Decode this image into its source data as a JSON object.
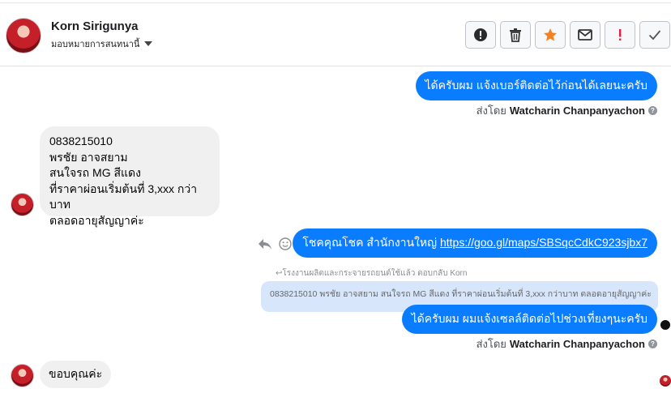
{
  "header": {
    "contact_name": "Korn Sirigunya",
    "assign_label": "มอบหมายการสนทนานี้"
  },
  "toolbar": {
    "buttons": [
      {
        "icon": "alert-icon"
      },
      {
        "icon": "trash-icon"
      },
      {
        "icon": "star-icon"
      },
      {
        "icon": "mail-icon"
      },
      {
        "icon": "exclamation-icon"
      },
      {
        "icon": "check-icon"
      }
    ]
  },
  "messages": {
    "m1": "ได้ครับผม แจ้งเบอร์ติดต่อไว้ก่อนได้เลยนะครับ",
    "m1_sentby_prefix": "ส่งโดย",
    "m1_sentby_name": "Watcharin Chanpanyachon",
    "m2_lines": [
      "0838215010",
      "พรชัย อาจสยาม",
      "สนใจรถ MG สีแดง",
      "ที่ราคาผ่อนเริ่มต้นที่ 3,xxx กว่าบาท",
      "ตลอดอายุสัญญาค่ะ"
    ],
    "m3_text": "โชคคุณโชค สำนักงานใหญ่ ",
    "m3_link": "https://goo.gl/maps/SBSqcCdkC923sjbx7",
    "reply_note": "โรงงานผลิตและกระจายรถยนต์ใช้แล้ว ตอบกลับ Korn",
    "quoted": "0838215010 พรชัย อาจสยาม สนใจรถ MG สีแดง ที่ราคาผ่อนเริ่มต้นที่ 3,xxx กว่าบาท ตลอดอายุสัญญาค่ะ",
    "m4": "ได้ครับผม ผมแจ้งเซลล์ติดต่อไปช่วงเที่ยงๆนะครับ",
    "m4_sentby_prefix": "ส่งโดย",
    "m4_sentby_name": "Watcharin Chanpanyachon",
    "m5": "ขอบคุณค่ะ"
  },
  "colors": {
    "outgoing": "#0a7cff",
    "incoming": "#f0f0f0",
    "star": "#f5821f",
    "alert": "#e41e3f"
  }
}
